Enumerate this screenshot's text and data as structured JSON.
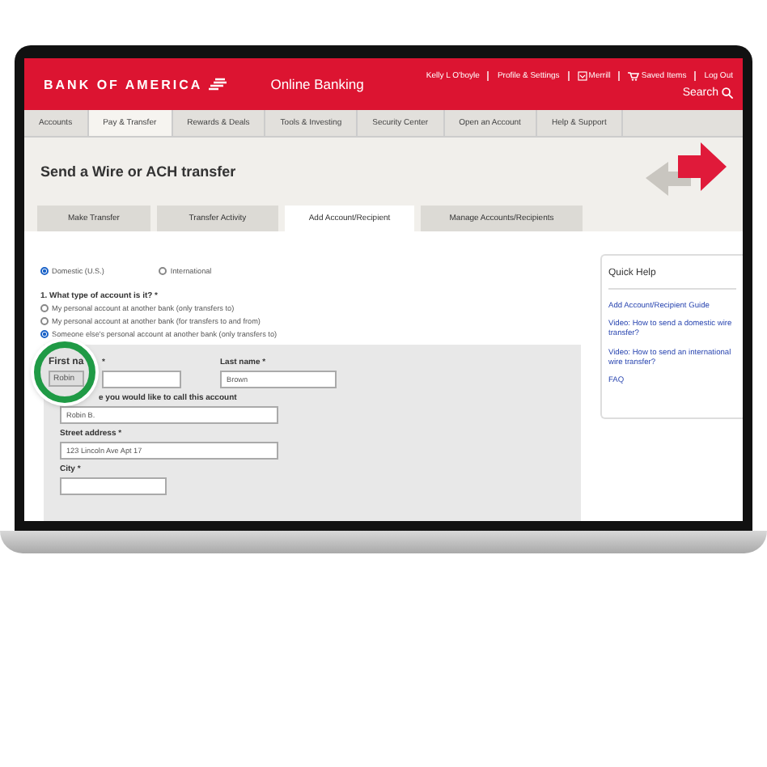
{
  "header": {
    "logo": "BANK OF AMERICA",
    "product": "Online Banking",
    "user": "Kelly L O'boyle",
    "links": [
      "Profile & Settings",
      "Merrill",
      "Saved Items",
      "Log Out"
    ],
    "search": "Search"
  },
  "nav": [
    {
      "label": "Accounts",
      "selected": false
    },
    {
      "label": "Pay & Transfer",
      "selected": true
    },
    {
      "label": "Rewards & Deals",
      "selected": false
    },
    {
      "label": "Tools & Investing",
      "selected": false
    },
    {
      "label": "Security Center",
      "selected": false
    },
    {
      "label": "Open an Account",
      "selected": false
    },
    {
      "label": "Help & Support",
      "selected": false
    }
  ],
  "page_title": "Send a Wire or ACH transfer",
  "tabs": [
    {
      "label": "Make Transfer",
      "selected": false
    },
    {
      "label": "Transfer Activity",
      "selected": false
    },
    {
      "label": "Add Account/Recipient",
      "selected": true
    },
    {
      "label": "Manage Accounts/Recipients",
      "selected": false
    }
  ],
  "destination": [
    {
      "label": "Domestic (U.S.)",
      "selected": true
    },
    {
      "label": "International",
      "selected": false
    }
  ],
  "question": "1. What type of account is it? *",
  "account_types": [
    {
      "label": "My personal account at another bank (only transfers to)",
      "selected": false
    },
    {
      "label": "My personal account at another bank (for transfers to and from)",
      "selected": false
    },
    {
      "label": "Someone else's personal account at another bank (only transfers to)",
      "selected": true
    }
  ],
  "form": {
    "magnifier": {
      "label": "First na",
      "value": "Robin"
    },
    "first_name_label_rest": "*",
    "last_name": {
      "label": "Last name *",
      "value": "Brown"
    },
    "nickname": {
      "label": "e you would like to call this account",
      "value": "Robin B."
    },
    "street": {
      "label": "Street address *",
      "value": "123 Lincoln Ave Apt 17"
    },
    "city": {
      "label": "City *"
    }
  },
  "quick_help": {
    "title": "Quick Help",
    "links": [
      "Add Account/Recipient Guide",
      "Video: How to send a domestic wire transfer?",
      "Video: How to send an international wire transfer?",
      "FAQ"
    ]
  }
}
